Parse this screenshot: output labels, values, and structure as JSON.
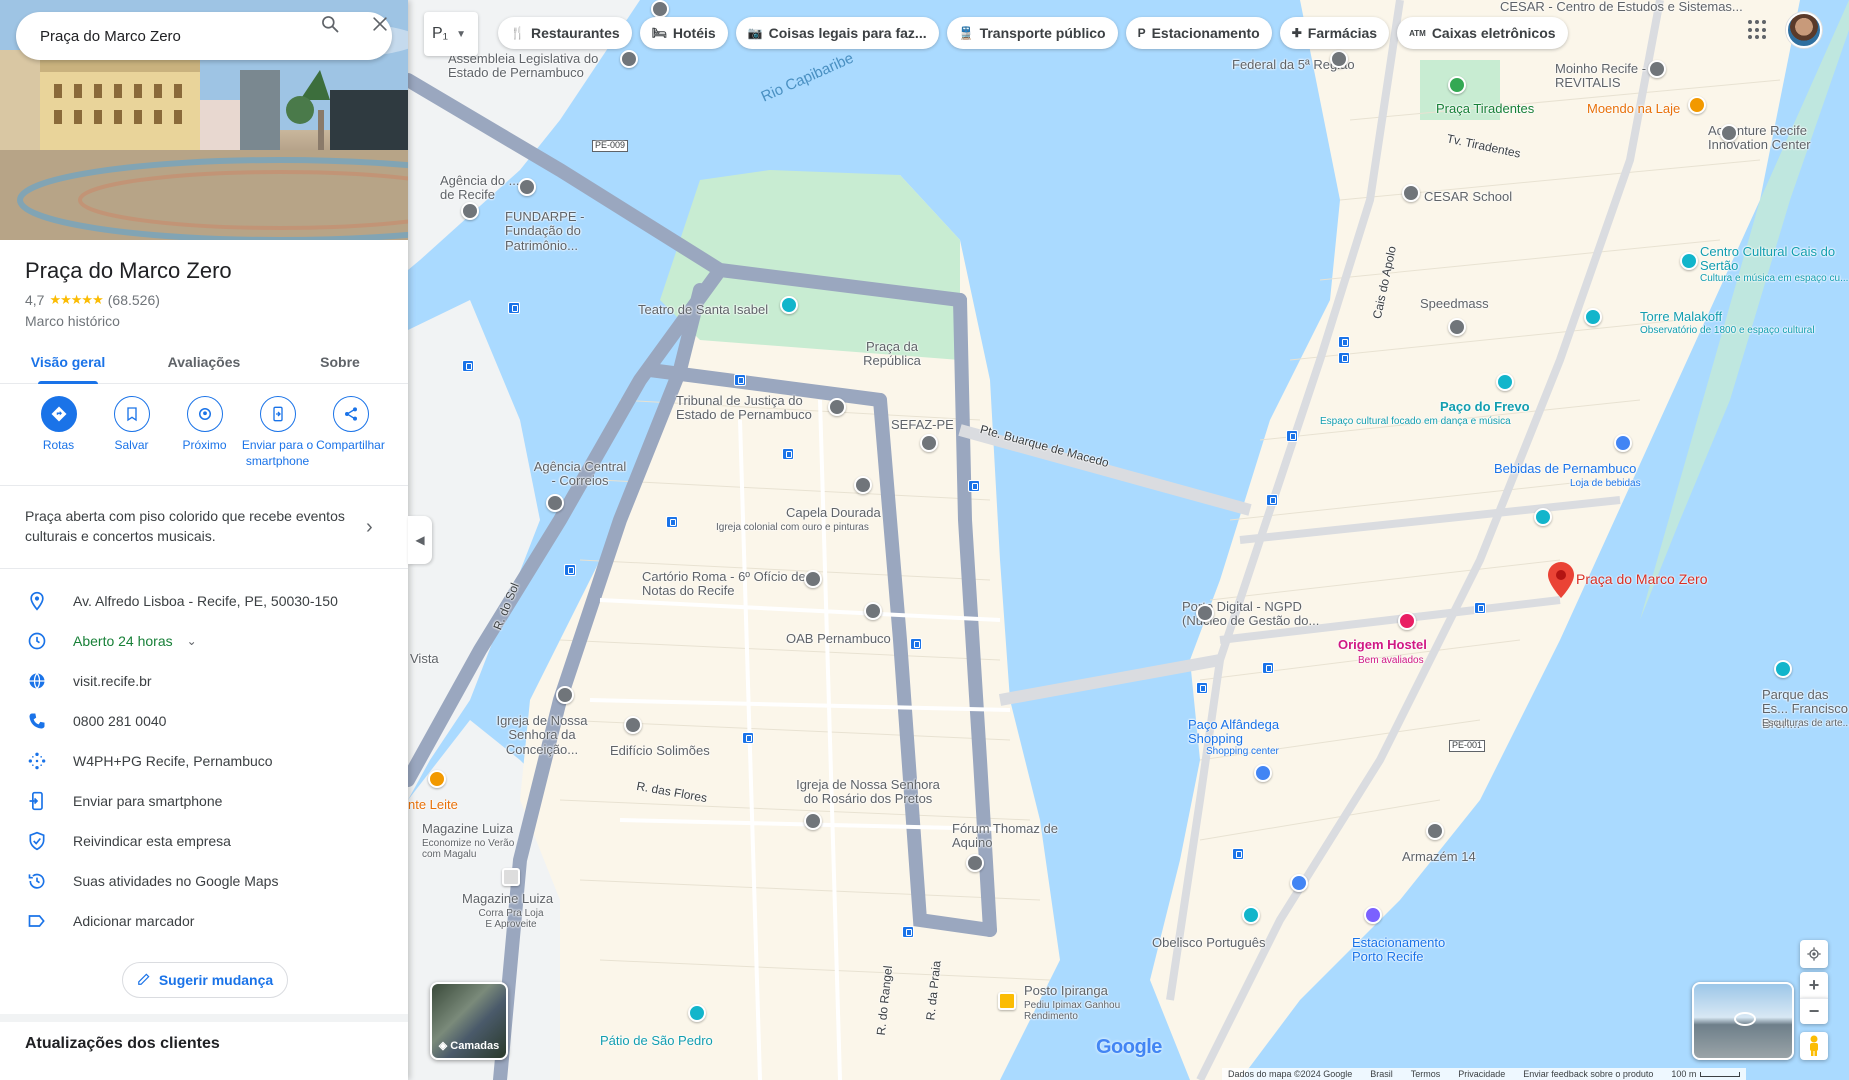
{
  "search": {
    "value": "Praça do Marco Zero"
  },
  "place": {
    "title": "Praça do Marco Zero",
    "rating": "4,7",
    "stars": "★★★★★",
    "reviews_count": "(68.526)",
    "category": "Marco histórico",
    "tabs": [
      {
        "label": "Visão geral"
      },
      {
        "label": "Avaliações"
      },
      {
        "label": "Sobre"
      }
    ],
    "actions": [
      {
        "label": "Rotas",
        "icon": "directions-icon"
      },
      {
        "label": "Salvar",
        "icon": "bookmark-icon"
      },
      {
        "label": "Próximo",
        "icon": "nearby-icon"
      },
      {
        "label": "Enviar para o smartphone",
        "icon": "send-to-phone-icon"
      },
      {
        "label": "Compartilhar",
        "icon": "share-icon"
      }
    ],
    "description": "Praça aberta com piso colorido que recebe eventos culturais e concertos musicais.",
    "info": [
      {
        "text": "Av. Alfredo Lisboa - Recife, PE, 50030-150",
        "icon": "location-icon"
      },
      {
        "text": "Aberto 24 horas",
        "icon": "clock-icon"
      },
      {
        "text": "visit.recife.br",
        "icon": "globe-icon"
      },
      {
        "text": "0800 281 0040",
        "icon": "phone-icon"
      },
      {
        "text": "W4PH+PG Recife, Pernambuco",
        "icon": "plus-code-icon"
      },
      {
        "text": "Enviar para smartphone",
        "icon": "send-to-phone-icon"
      },
      {
        "text": "Reivindicar esta empresa",
        "icon": "shield-icon"
      },
      {
        "text": "Suas atividades no Google Maps",
        "icon": "history-icon"
      },
      {
        "text": "Adicionar marcador",
        "icon": "label-icon"
      }
    ],
    "suggest_label": "Sugerir mudança",
    "updates_title": "Atualizações dos clientes"
  },
  "chips": [
    {
      "label": "Restaurantes",
      "icon": "fork-knife-icon"
    },
    {
      "label": "Hotéis",
      "icon": "bed-icon"
    },
    {
      "label": "Coisas legais para faz...",
      "icon": "camera-icon"
    },
    {
      "label": "Transporte público",
      "icon": "train-icon"
    },
    {
      "label": "Estacionamento",
      "icon": "parking-icon"
    },
    {
      "label": "Farmácias",
      "icon": "pharmacy-icon"
    },
    {
      "label": "Caixas eletrônicos",
      "icon": "atm-icon"
    }
  ],
  "transit_glyph": "P₁",
  "map": {
    "labels": {
      "cesar": "CESAR - Centro de Estudos e Sistemas...",
      "assembleia": "Assembleia Legislativa do Estado de Pernambuco",
      "federal": "Federal da 5ª Região",
      "moinho": "Moinho Recife - REVITALIS",
      "moendo": "Moendo na Laje",
      "accenture": "Accenture Recife Innovation Center",
      "rio": "Rio Capibaribe",
      "praca_tiradentes": "Praça Tiradentes",
      "tv_tiradentes": "Tv. Tiradentes",
      "cesar_school": "CESAR School",
      "agencia": "Agência do ... de Recife",
      "fundarpe": "FUNDARPE - Fundação do Patrimônio...",
      "pe009": "PE-009",
      "teatro": "Teatro de Santa Isabel",
      "praca_republica": "Praça da República",
      "cais_apolo": "Cais do Apolo",
      "speedmass": "Speedmass",
      "centro_cultural": "Centro Cultural Cais do Sertão",
      "centro_cultural_sub": "Cultura e música em espaço cu...",
      "torre": "Torre Malakoff",
      "torre_sub": "Observatório de 1800 e espaço cultural",
      "tribunal": "Tribunal de Justiça do Estado de Pernambuco",
      "sefaz": "SEFAZ-PE",
      "ponte": "Pte. Buarque de Macedo",
      "paco_frevo": "Paço do Frevo",
      "paco_frevo_sub": "Espaço cultural focado em dança e música",
      "agencia_central": "Agência Central - Correios",
      "bebidas": "Bebidas de Pernambuco",
      "bebidas_sub": "Loja de bebidas",
      "capela": "Capela Dourada",
      "capela_sub": "Igreja colonial com ouro e pinturas",
      "marco_zero": "Praça do Marco Zero",
      "cartorio": "Cartório Roma - 6º Ofício de Notas do Recife",
      "porto_digital": "Porto Digital - NGPD (Núcleo de Gestão do...",
      "origem": "Origem Hostel",
      "origem_sub": "Bem avaliados",
      "oab": "OAB Pernambuco",
      "r_sol": "R. do Sol",
      "vista": "Vista",
      "parque": "Parque das Es... Francisco Bren...",
      "parque_sub": "Esculturas de arte...",
      "igreja_conceicao": "Igreja de Nossa Senhora da Conceição...",
      "edificio": "Edifício Solimões",
      "paco_alfandega": "Paço Alfândega Shopping",
      "paco_alfandega_sub": "Shopping center",
      "pe001": "PE-001",
      "r_flores": "R. das Flores",
      "igreja_rosario": "Igreja de Nossa Senhora do Rosário dos Pretos",
      "leite": "nte Leite",
      "magazine1": "Magazine Luiza",
      "magazine1_sub": "Economize no Verão com Magalu",
      "forum": "Fórum Thomaz de Aquino",
      "armazem": "Armazém 14",
      "magazine2": "Magazine Luiza",
      "magazine2_sub": "Corra Pra Loja E Aproveite",
      "obelisco": "Obelisco Português",
      "estacionamento": "Estacionamento Porto Recife",
      "r_rangel": "R. do Rangel",
      "r_praia": "R. da Praia",
      "posto": "Posto Ipiranga",
      "posto_sub": "Pediu Ipimax Ganhou Rendimento",
      "patio": "Pátio de São Pedro"
    }
  },
  "controls": {
    "layers_label": "Camadas",
    "zoom_in": "+",
    "zoom_out": "−",
    "collapse": "◀"
  },
  "google_logo": "Google",
  "footer": {
    "data": "Dados do mapa ©2024 Google",
    "country": "Brasil",
    "terms": "Termos",
    "privacy": "Privacidade",
    "feedback": "Enviar feedback sobre o produto",
    "scale": "100 m"
  },
  "colors": {
    "water": "#aadaff",
    "land": "#f8f9fa",
    "road": "#9aa7bf",
    "park": "#c8ecd2",
    "accent": "#1a73e8",
    "marker": "#ea4335"
  }
}
